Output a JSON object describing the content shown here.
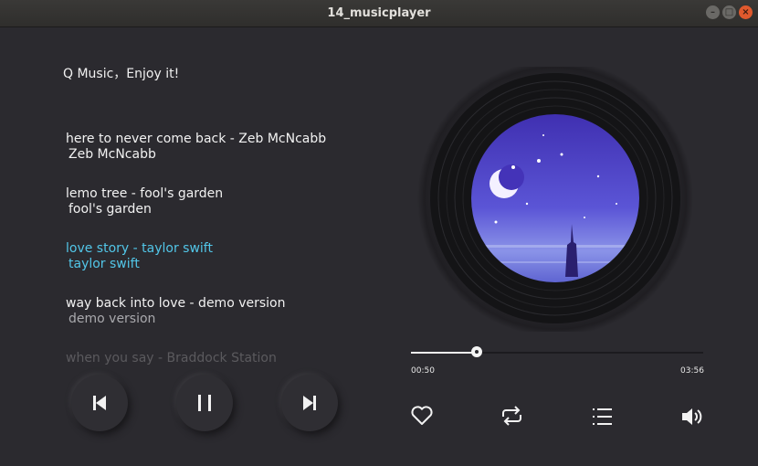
{
  "window": {
    "title": "14_musicplayer"
  },
  "greeting": "Q Music，Enjoy it!",
  "playlist": [
    {
      "name": "here to never come back - Zeb McNcabb",
      "artist": "Zeb McNcabb",
      "state": "normal"
    },
    {
      "name": "lemo tree - fool's garden",
      "artist": "fool's garden",
      "state": "normal"
    },
    {
      "name": "love story - taylor swift",
      "artist": "taylor swift",
      "state": "active"
    },
    {
      "name": "way back into love - demo version",
      "artist": "demo version",
      "state": "dim"
    },
    {
      "name": "when you say - Braddock Station",
      "artist": "",
      "state": "faded"
    }
  ],
  "player": {
    "current_time": "00:50",
    "total_time": "03:56",
    "progress": 0.226
  },
  "colors": {
    "accent": "#52c6e8",
    "background": "#2b2a2f"
  },
  "icons": {
    "controls": [
      "previous-icon",
      "pause-icon",
      "next-icon"
    ],
    "actions": [
      "heart-icon",
      "repeat-icon",
      "playlist-icon",
      "volume-icon"
    ]
  }
}
